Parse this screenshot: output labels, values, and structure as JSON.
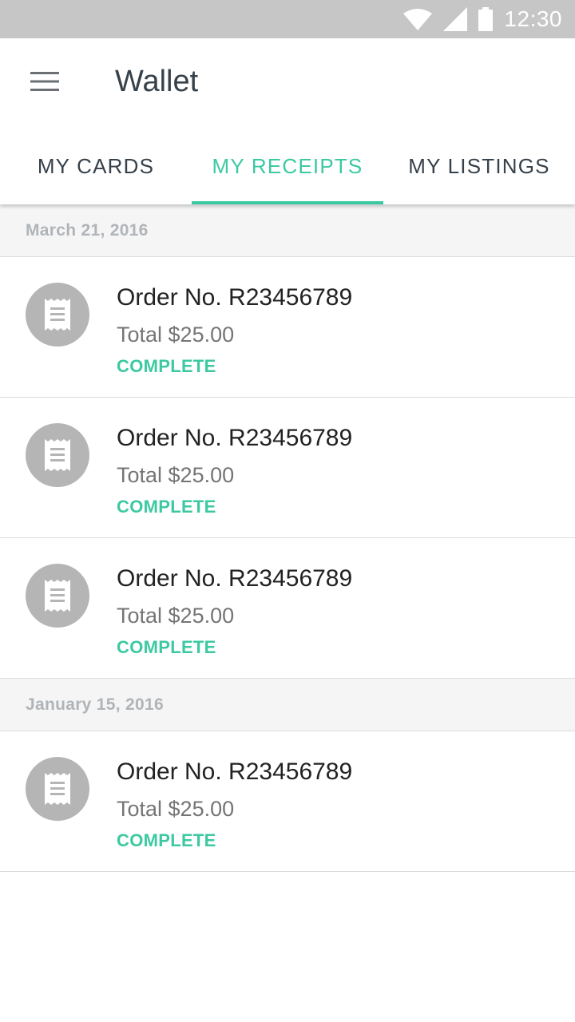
{
  "status_bar": {
    "time": "12:30",
    "icons": [
      "wifi-icon",
      "signal-icon",
      "battery-icon"
    ]
  },
  "app_bar": {
    "title": "Wallet",
    "menu_icon": "hamburger-menu-icon"
  },
  "tabs": [
    {
      "label": "MY CARDS",
      "active": false
    },
    {
      "label": "MY RECEIPTS",
      "active": true
    },
    {
      "label": "MY LISTINGS",
      "active": false
    }
  ],
  "colors": {
    "accent": "#3cc9a2",
    "status_bar": "#c6c6c6",
    "title_text": "#37414a",
    "icon_circle": "#b5b5b5"
  },
  "sections": [
    {
      "date": "March 21, 2016",
      "receipts": [
        {
          "order": "Order No. R23456789",
          "total": "Total $25.00",
          "status": "COMPLETE",
          "icon": "receipt-icon"
        },
        {
          "order": "Order No. R23456789",
          "total": "Total $25.00",
          "status": "COMPLETE",
          "icon": "receipt-icon"
        },
        {
          "order": "Order No. R23456789",
          "total": "Total $25.00",
          "status": "COMPLETE",
          "icon": "receipt-icon"
        }
      ]
    },
    {
      "date": "January 15, 2016",
      "receipts": [
        {
          "order": "Order No. R23456789",
          "total": "Total $25.00",
          "status": "COMPLETE",
          "icon": "receipt-icon"
        }
      ]
    }
  ]
}
